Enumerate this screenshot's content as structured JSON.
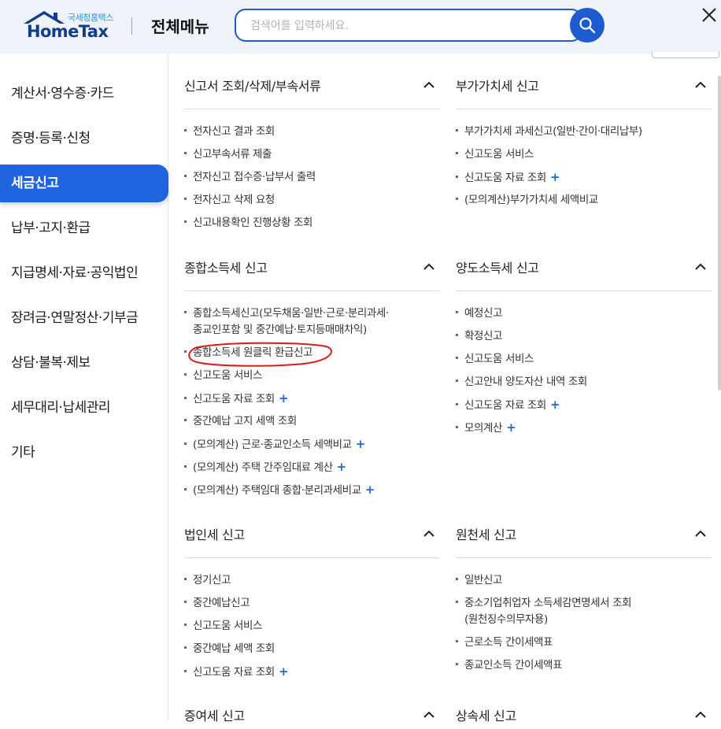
{
  "header": {
    "logo_sub": "국세청홈택스",
    "logo_main": "HomeTax",
    "title": "전체메뉴",
    "search_placeholder": "검색어를 입력하세요."
  },
  "sidebar": {
    "items": [
      {
        "label": "계산서·영수증·카드"
      },
      {
        "label": "증명·등록·신청"
      },
      {
        "label": "세금신고",
        "active": true
      },
      {
        "label": "납부·고지·환급"
      },
      {
        "label": "지급명세·자료·공익법인"
      },
      {
        "label": "장려금·연말정산·기부금"
      },
      {
        "label": "상담·불복·제보"
      },
      {
        "label": "세무대리·납세관리"
      },
      {
        "label": "기타"
      }
    ]
  },
  "sections": {
    "s1": {
      "title": "신고서 조회/삭제/부속서류",
      "items": [
        "전자신고 결과 조회",
        "신고부속서류 제출",
        "전자신고 접수증·납부서 출력",
        "전자신고 삭제 요청",
        "신고내용확인 진행상황 조회"
      ]
    },
    "s2": {
      "title": "부가가치세 신고",
      "items": [
        "부가가치세 과세신고(일반·간이·대리납부)",
        "신고도움 서비스",
        "신고도움 자료 조회",
        "(모의계산)부가가치세 세액비교"
      ]
    },
    "s3": {
      "title": "종합소득세 신고",
      "items": [
        "종합소득세신고(모두채움·일반·근로·분리과세·",
        "종교인포함 및 중간예납·토지등매매차익)",
        "종합소득세 원클릭 환급신고",
        "신고도움 서비스",
        "신고도움 자료 조회",
        "중간예납 고지 세액 조회",
        "(모의계산) 근로·종교인소득 세액비교",
        "(모의계산) 주택 간주임대료 계산",
        "(모의계산) 주택임대 종합·분리과세비교"
      ]
    },
    "s4": {
      "title": "양도소득세 신고",
      "items": [
        "예정신고",
        "확정신고",
        "신고도움 서비스",
        "신고안내 양도자산 내역 조회",
        "신고도움 자료 조회",
        "모의계산"
      ]
    },
    "s5": {
      "title": "법인세 신고",
      "items": [
        "정기신고",
        "중간예납신고",
        "신고도움 서비스",
        "중간예납 세액 조회",
        "신고도움 자료 조회"
      ]
    },
    "s6": {
      "title": "원천세 신고",
      "items": [
        "일반신고",
        "중소기업취업자 소득세감면명세서 조회",
        "(원천징수의무자용)",
        "근로소득 간이세액표",
        "종교인소득 간이세액표"
      ]
    },
    "s7": {
      "title": "증여세 신고"
    },
    "s8": {
      "title": "상속세 신고"
    }
  }
}
